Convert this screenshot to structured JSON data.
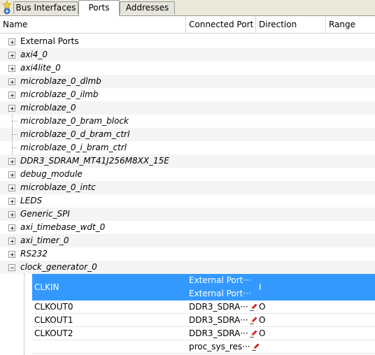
{
  "tabs": [
    {
      "label": "Bus Interfaces"
    },
    {
      "label": "Ports"
    },
    {
      "label": "Addresses"
    }
  ],
  "columns": {
    "name": "Name",
    "connected_port": "Connected Port",
    "direction": "Direction",
    "range": "Range"
  },
  "tree": [
    {
      "label": "External Ports",
      "expander": "plus",
      "italic": false
    },
    {
      "label": "axi4_0",
      "expander": "plus",
      "italic": true
    },
    {
      "label": "axi4lite_0",
      "expander": "plus",
      "italic": true
    },
    {
      "label": "microblaze_0_dlmb",
      "expander": "plus",
      "italic": true
    },
    {
      "label": "microblaze_0_ilmb",
      "expander": "plus",
      "italic": true
    },
    {
      "label": "microblaze_0",
      "expander": "plus",
      "italic": true
    },
    {
      "label": "microblaze_0_bram_block",
      "expander": "none",
      "italic": true
    },
    {
      "label": "microblaze_0_d_bram_ctrl",
      "expander": "none",
      "italic": true
    },
    {
      "label": "microblaze_0_i_bram_ctrl",
      "expander": "none",
      "italic": true
    },
    {
      "label": "DDR3_SDRAM_MT41J256M8XX_15E",
      "expander": "plus",
      "italic": true
    },
    {
      "label": "debug_module",
      "expander": "plus",
      "italic": true
    },
    {
      "label": "microblaze_0_intc",
      "expander": "plus",
      "italic": true
    },
    {
      "label": "LEDS",
      "expander": "plus",
      "italic": true
    },
    {
      "label": "Generic_SPI",
      "expander": "plus",
      "italic": true
    },
    {
      "label": "axi_timebase_wdt_0",
      "expander": "plus",
      "italic": true
    },
    {
      "label": "axi_timer_0",
      "expander": "plus",
      "italic": true
    },
    {
      "label": "RS232",
      "expander": "plus",
      "italic": true
    },
    {
      "label": "clock_generator_0",
      "expander": "minus",
      "italic": true
    }
  ],
  "ports": [
    {
      "name": "CLKIN",
      "connected": [
        "External Port···",
        "External Port···"
      ],
      "direction": "I",
      "selected": true,
      "editable": false
    },
    {
      "name": "CLKOUT0",
      "connected": [
        "DDR3_SDRA···"
      ],
      "direction": "O",
      "selected": false,
      "editable": true
    },
    {
      "name": "CLKOUT1",
      "connected": [
        "DDR3_SDRA···"
      ],
      "direction": "O",
      "selected": false,
      "editable": true
    },
    {
      "name": "CLKOUT2",
      "connected": [
        "DDR3_SDRA···"
      ],
      "direction": "O",
      "selected": false,
      "editable": true
    },
    {
      "name": "",
      "connected": [
        "proc_sys_res···"
      ],
      "direction": "",
      "selected": false,
      "editable": true
    }
  ],
  "colors": {
    "selection": "#3399ff",
    "tab_bg": "#ece9d8",
    "pencil_red": "#d42020"
  },
  "icons": {
    "add": "add-star-icon",
    "edit": "pencil-icon"
  }
}
